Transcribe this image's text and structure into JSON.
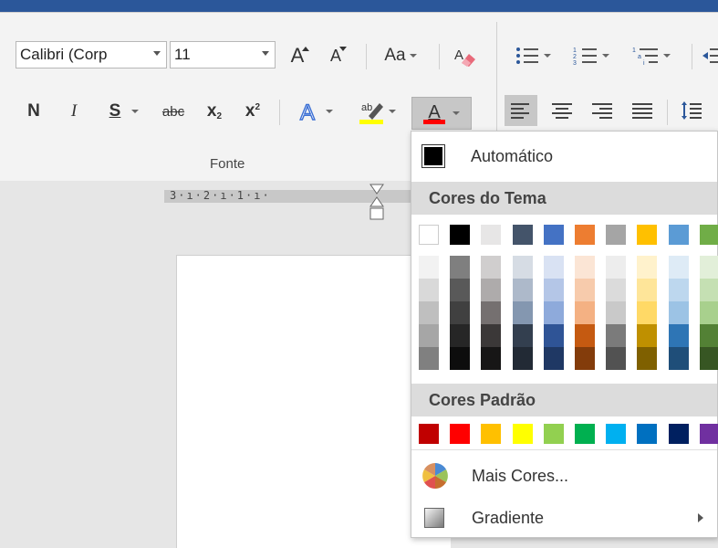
{
  "ribbon": {
    "font_name": "Calibri (Corp",
    "font_size": "11",
    "grow_font": "A",
    "shrink_font": "A",
    "change_case": "Aa",
    "bold": "N",
    "italic": "I",
    "underline": "S",
    "strikethrough": "abc",
    "subscript": "x",
    "superscript": "x",
    "font_color": "A",
    "group_label": "Fonte"
  },
  "ruler": {
    "text": "3·ı·2·ı·1·ı·"
  },
  "font_color_menu": {
    "automatic_label": "Automático",
    "theme_colors_header": "Cores do Tema",
    "standard_colors_header": "Cores Padrão",
    "more_colors_label": "Mais Cores...",
    "gradient_label": "Gradiente",
    "theme_colors": [
      "#ffffff",
      "#000000",
      "#e7e6e6",
      "#44546a",
      "#4472c4",
      "#ed7d31",
      "#a5a5a5",
      "#ffc000",
      "#5b9bd5",
      "#70ad47"
    ],
    "theme_shades": [
      [
        "#f2f2f2",
        "#d9d9d9",
        "#bfbfbf",
        "#a6a6a6",
        "#808080"
      ],
      [
        "#7f7f7f",
        "#595959",
        "#404040",
        "#262626",
        "#0d0d0d"
      ],
      [
        "#d0cece",
        "#aeabab",
        "#757070",
        "#3b3838",
        "#171616"
      ],
      [
        "#d6dce4",
        "#adb9ca",
        "#8497b0",
        "#333f4f",
        "#222a35"
      ],
      [
        "#d9e2f3",
        "#b4c6e7",
        "#8eaadb",
        "#2f5496",
        "#1f3864"
      ],
      [
        "#fbe5d5",
        "#f7cbac",
        "#f4b183",
        "#c55a11",
        "#833c0b"
      ],
      [
        "#ededed",
        "#dbdbdb",
        "#c9c9c9",
        "#7b7b7b",
        "#525252"
      ],
      [
        "#fff2cc",
        "#fee599",
        "#ffd966",
        "#bf9000",
        "#7f6000"
      ],
      [
        "#deebf6",
        "#bdd7ee",
        "#9cc3e5",
        "#2e75b5",
        "#1f4e79"
      ],
      [
        "#e2efd9",
        "#c5e0b3",
        "#a8d08d",
        "#538135",
        "#375623"
      ]
    ],
    "standard_colors": [
      "#c00000",
      "#ff0000",
      "#ffc000",
      "#ffff00",
      "#92d050",
      "#00b050",
      "#00b0f0",
      "#0070c0",
      "#002060",
      "#7030a0"
    ]
  }
}
